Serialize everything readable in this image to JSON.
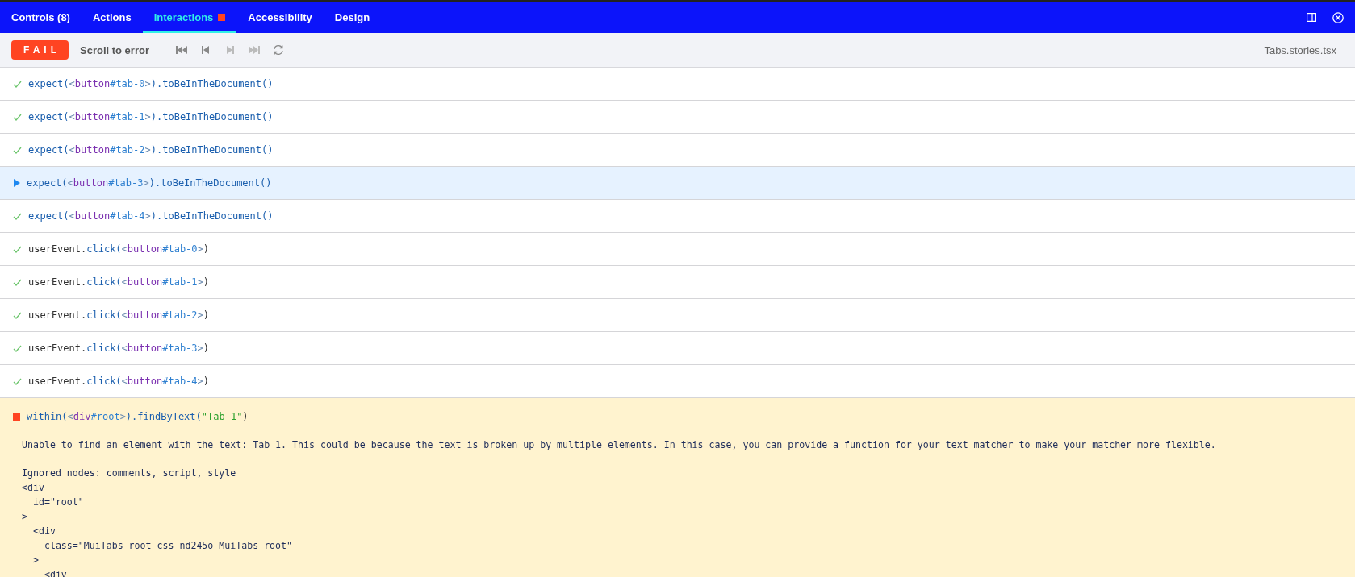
{
  "tabs": [
    {
      "label": "Controls (8)",
      "selected": false,
      "has_error": false
    },
    {
      "label": "Actions",
      "selected": false,
      "has_error": false
    },
    {
      "label": "Interactions",
      "selected": true,
      "has_error": true
    },
    {
      "label": "Accessibility",
      "selected": false,
      "has_error": false
    },
    {
      "label": "Design",
      "selected": false,
      "has_error": false
    }
  ],
  "toolbar": {
    "status": "FAIL",
    "scroll_button": "Scroll to error",
    "nav": [
      {
        "kind": "first",
        "disabled": false
      },
      {
        "kind": "back",
        "disabled": false
      },
      {
        "kind": "next",
        "disabled": true
      },
      {
        "kind": "last",
        "disabled": true
      },
      {
        "kind": "rerun",
        "disabled": false
      }
    ],
    "file": "Tabs.stories.tsx"
  },
  "steps": [
    {
      "kind": "passed",
      "selected": false,
      "tokens": [
        {
          "kind": "fn",
          "text": "expect("
        },
        {
          "kind": "punct",
          "text": "<"
        },
        {
          "kind": "tag",
          "text": "button"
        },
        {
          "kind": "id",
          "text": "#tab-0"
        },
        {
          "kind": "punct",
          "text": ">"
        },
        {
          "kind": "fn",
          "text": ").toBeInTheDocument()"
        }
      ]
    },
    {
      "kind": "passed",
      "selected": false,
      "tokens": [
        {
          "kind": "fn",
          "text": "expect("
        },
        {
          "kind": "punct",
          "text": "<"
        },
        {
          "kind": "tag",
          "text": "button"
        },
        {
          "kind": "id",
          "text": "#tab-1"
        },
        {
          "kind": "punct",
          "text": ">"
        },
        {
          "kind": "fn",
          "text": ").toBeInTheDocument()"
        }
      ]
    },
    {
      "kind": "passed",
      "selected": false,
      "tokens": [
        {
          "kind": "fn",
          "text": "expect("
        },
        {
          "kind": "punct",
          "text": "<"
        },
        {
          "kind": "tag",
          "text": "button"
        },
        {
          "kind": "id",
          "text": "#tab-2"
        },
        {
          "kind": "punct",
          "text": ">"
        },
        {
          "kind": "fn",
          "text": ").toBeInTheDocument()"
        }
      ]
    },
    {
      "kind": "active",
      "selected": true,
      "tokens": [
        {
          "kind": "fn",
          "text": "expect("
        },
        {
          "kind": "punct",
          "text": "<"
        },
        {
          "kind": "tag",
          "text": "button"
        },
        {
          "kind": "id",
          "text": "#tab-3"
        },
        {
          "kind": "punct",
          "text": ">"
        },
        {
          "kind": "fn",
          "text": ").toBeInTheDocument()"
        }
      ]
    },
    {
      "kind": "passed",
      "selected": false,
      "tokens": [
        {
          "kind": "fn",
          "text": "expect("
        },
        {
          "kind": "punct",
          "text": "<"
        },
        {
          "kind": "tag",
          "text": "button"
        },
        {
          "kind": "id",
          "text": "#tab-4"
        },
        {
          "kind": "punct",
          "text": ">"
        },
        {
          "kind": "fn",
          "text": ").toBeInTheDocument()"
        }
      ]
    },
    {
      "kind": "passed",
      "selected": false,
      "tokens": [
        {
          "kind": "plain",
          "text": "userEvent."
        },
        {
          "kind": "fn",
          "text": "click("
        },
        {
          "kind": "punct",
          "text": "<"
        },
        {
          "kind": "tag",
          "text": "button"
        },
        {
          "kind": "id",
          "text": "#tab-0"
        },
        {
          "kind": "punct",
          "text": ">"
        },
        {
          "kind": "plain",
          "text": ")"
        }
      ]
    },
    {
      "kind": "passed",
      "selected": false,
      "tokens": [
        {
          "kind": "plain",
          "text": "userEvent."
        },
        {
          "kind": "fn",
          "text": "click("
        },
        {
          "kind": "punct",
          "text": "<"
        },
        {
          "kind": "tag",
          "text": "button"
        },
        {
          "kind": "id",
          "text": "#tab-1"
        },
        {
          "kind": "punct",
          "text": ">"
        },
        {
          "kind": "plain",
          "text": ")"
        }
      ]
    },
    {
      "kind": "passed",
      "selected": false,
      "tokens": [
        {
          "kind": "plain",
          "text": "userEvent."
        },
        {
          "kind": "fn",
          "text": "click("
        },
        {
          "kind": "punct",
          "text": "<"
        },
        {
          "kind": "tag",
          "text": "button"
        },
        {
          "kind": "id",
          "text": "#tab-2"
        },
        {
          "kind": "punct",
          "text": ">"
        },
        {
          "kind": "plain",
          "text": ")"
        }
      ]
    },
    {
      "kind": "passed",
      "selected": false,
      "tokens": [
        {
          "kind": "plain",
          "text": "userEvent."
        },
        {
          "kind": "fn",
          "text": "click("
        },
        {
          "kind": "punct",
          "text": "<"
        },
        {
          "kind": "tag",
          "text": "button"
        },
        {
          "kind": "id",
          "text": "#tab-3"
        },
        {
          "kind": "punct",
          "text": ">"
        },
        {
          "kind": "plain",
          "text": ")"
        }
      ]
    },
    {
      "kind": "passed",
      "selected": false,
      "tokens": [
        {
          "kind": "plain",
          "text": "userEvent."
        },
        {
          "kind": "fn",
          "text": "click("
        },
        {
          "kind": "punct",
          "text": "<"
        },
        {
          "kind": "tag",
          "text": "button"
        },
        {
          "kind": "id",
          "text": "#tab-4"
        },
        {
          "kind": "punct",
          "text": ">"
        },
        {
          "kind": "plain",
          "text": ")"
        }
      ]
    }
  ],
  "error": {
    "kind": "failed",
    "tokens": [
      {
        "kind": "fn",
        "text": "within("
      },
      {
        "kind": "punct",
        "text": "<"
      },
      {
        "kind": "tag",
        "text": "div"
      },
      {
        "kind": "id",
        "text": "#root"
      },
      {
        "kind": "punct",
        "text": ">"
      },
      {
        "kind": "fn",
        "text": ").findByText("
      },
      {
        "kind": "string",
        "text": "\"Tab 1\""
      },
      {
        "kind": "plain",
        "text": ")"
      }
    ],
    "message": "Unable to find an element with the text: Tab 1. This could be because the text is broken up by multiple elements. In this case, you can provide a function for your text matcher to make your matcher more flexible.",
    "dom_lines": [
      "Ignored nodes: comments, script, style",
      "<div",
      "  id=\"root\"",
      ">",
      "  <div",
      "    class=\"MuiTabs-root css-nd245o-MuiTabs-root\"",
      "  >",
      "    <div"
    ]
  }
}
